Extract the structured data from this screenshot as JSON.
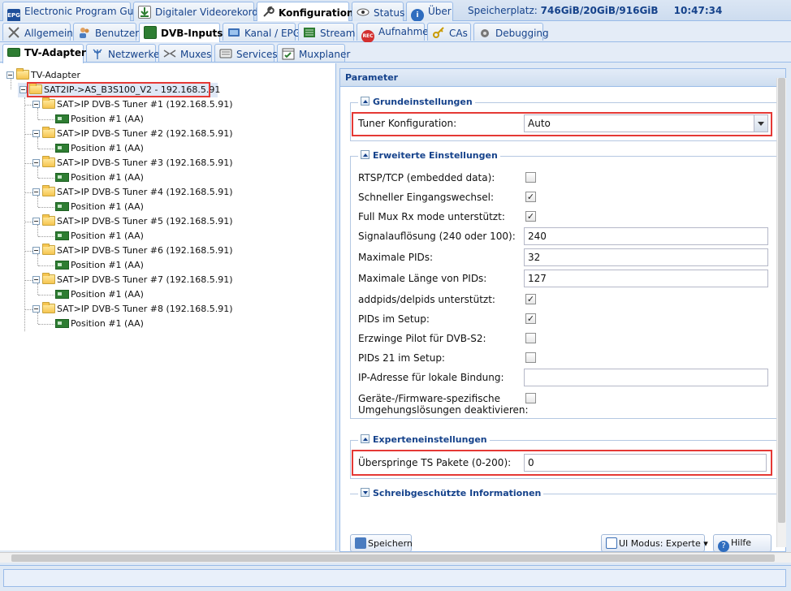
{
  "tabs_top": [
    {
      "label": "Electronic Program Guide",
      "icon": "epg-icon"
    },
    {
      "label": "Digitaler Videorekorder",
      "icon": "download-icon"
    },
    {
      "label": "Konfiguration",
      "icon": "wrench-icon"
    },
    {
      "label": "Status",
      "icon": "eye-icon"
    },
    {
      "label": "Über",
      "icon": "info-icon"
    }
  ],
  "status": {
    "label": "Speicherplatz:",
    "storage": "746GiB/20GiB/916GiB",
    "time": "10:47:34"
  },
  "tabs_config": [
    {
      "label": "Allgemein",
      "icon": "tools-icon"
    },
    {
      "label": "Benutzer",
      "icon": "users-icon"
    },
    {
      "label": "DVB-Inputs",
      "icon": "tv-card-icon"
    },
    {
      "label": "Kanal / EPG",
      "icon": "tv-icon"
    },
    {
      "label": "Stream",
      "icon": "stream-icon"
    },
    {
      "label": "Aufnahme",
      "icon": "rec-icon"
    },
    {
      "label": "CAs",
      "icon": "key-icon"
    },
    {
      "label": "Debugging",
      "icon": "bug-icon"
    }
  ],
  "tabs_dvb": [
    {
      "label": "TV-Adapter",
      "icon": "tv-card-icon"
    },
    {
      "label": "Netzwerke",
      "icon": "antenna-icon"
    },
    {
      "label": "Muxes",
      "icon": "mux-icon"
    },
    {
      "label": "Services",
      "icon": "services-icon"
    },
    {
      "label": "Muxplaner",
      "icon": "scheduler-icon"
    }
  ],
  "tree": {
    "root": "TV-Adapter",
    "adapter": "SAT2IP->AS_B3S100_V2 - 192.168.5.91",
    "tuners": [
      {
        "label": "SAT>IP DVB-S Tuner #1 (192.168.5.91)",
        "child": "Position #1 (AA)"
      },
      {
        "label": "SAT>IP DVB-S Tuner #2 (192.168.5.91)",
        "child": "Position #1 (AA)"
      },
      {
        "label": "SAT>IP DVB-S Tuner #3 (192.168.5.91)",
        "child": "Position #1 (AA)"
      },
      {
        "label": "SAT>IP DVB-S Tuner #4 (192.168.5.91)",
        "child": "Position #1 (AA)"
      },
      {
        "label": "SAT>IP DVB-S Tuner #5 (192.168.5.91)",
        "child": "Position #1 (AA)"
      },
      {
        "label": "SAT>IP DVB-S Tuner #6 (192.168.5.91)",
        "child": "Position #1 (AA)"
      },
      {
        "label": "SAT>IP DVB-S Tuner #7 (192.168.5.91)",
        "child": "Position #1 (AA)"
      },
      {
        "label": "SAT>IP DVB-S Tuner #8 (192.168.5.91)",
        "child": "Position #1 (AA)"
      }
    ]
  },
  "params": {
    "header": "Parameter",
    "grund": {
      "title": "Grundeinstellungen",
      "tuner_label": "Tuner Konfiguration:",
      "tuner_value": "Auto"
    },
    "erweitert": {
      "title": "Erweiterte Einstellungen",
      "rtsp": "RTSP/TCP (embedded data):",
      "schneller": "Schneller Eingangswechsel:",
      "fullmux": "Full Mux Rx mode unterstützt:",
      "signal_label": "Signalauflösung (240 oder 100):",
      "signal_value": "240",
      "maxpids_label": "Maximale PIDs:",
      "maxpids_value": "32",
      "maxlen_label": "Maximale Länge von PIDs:",
      "maxlen_value": "127",
      "addpids": "addpids/delpids unterstützt:",
      "pidssetup": "PIDs im Setup:",
      "pilot": "Erzwinge Pilot für DVB-S2:",
      "pids21": "PIDs 21 im Setup:",
      "ipaddr": "IP-Adresse für lokale Bindung:",
      "ipaddr_value": "",
      "geraete1": "Geräte-/Firmware-spezifische",
      "geraete2": "Umgehungslösungen deaktivieren:",
      "checks": {
        "rtsp": false,
        "schneller": true,
        "fullmux": true,
        "addpids": true,
        "pidssetup": true,
        "pilot": false,
        "pids21": false,
        "geraete": false
      }
    },
    "experten": {
      "title": "Experteneinstellungen",
      "skip_label": "Überspringe TS Pakete (0-200):",
      "skip_value": "0"
    },
    "readonly": {
      "title": "Schreibgeschützte Informationen"
    },
    "buttons": {
      "save": "Speichern",
      "uimode": "UI Modus: Experte",
      "help": "Hilfe"
    }
  }
}
